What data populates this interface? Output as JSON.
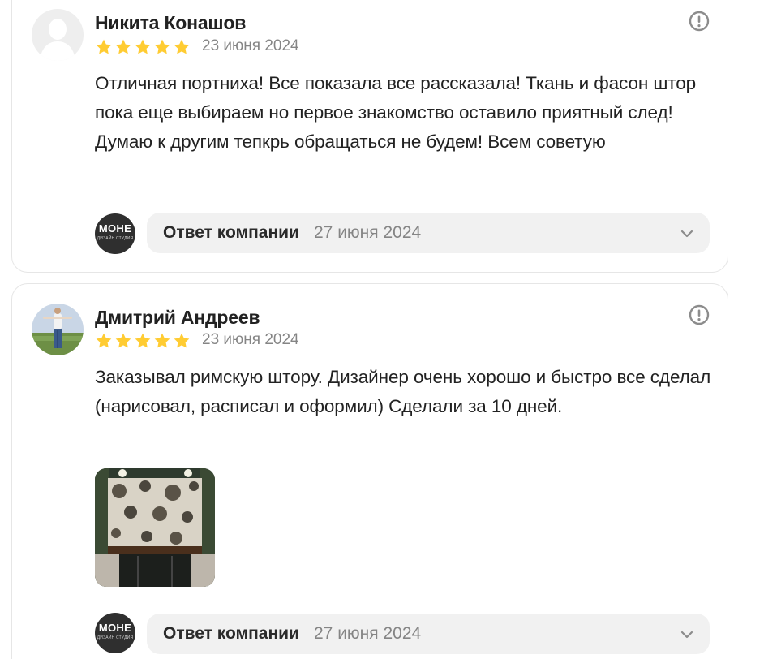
{
  "reviews": [
    {
      "author": "Никита Конашов",
      "rating": 5,
      "date": "23 июня 2024",
      "text": "Отличная портниха! Все показала все рассказала! Ткань и фасон штор пока еще выбираем но первое знакомство оставило приятный след! Думаю к другим тепкрь обращаться не будем! Всем советую",
      "reply_label": "Ответ компании",
      "reply_date": "27 июня 2024"
    },
    {
      "author": "Дмитрий Андреев",
      "rating": 5,
      "date": "23 июня 2024",
      "text": "Заказывал римскую штору. Дизайнер очень хорошо и быстро все сделал (нарисовал, расписал и оформил) Сделали за 10 дней.",
      "reply_label": "Ответ компании",
      "reply_date": "27 июня 2024"
    }
  ],
  "company_logo": {
    "main": "MOHE",
    "sub": "ДИЗАЙН СТУДИЯ"
  },
  "icons": {
    "report": "exclamation-circle-icon",
    "expand": "chevron-down-icon",
    "star": "star-icon"
  },
  "colors": {
    "star": "#ffcc33",
    "muted_text": "#858585",
    "reply_bg": "#f1f1f1",
    "card_border": "#e6e6e6"
  }
}
